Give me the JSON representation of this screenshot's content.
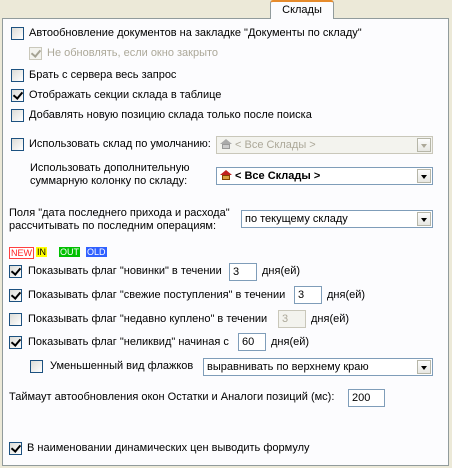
{
  "tab": {
    "label": "Склады"
  },
  "options": {
    "auto_update_docs": "Автообновление документов на закладке \"Документы по складу\"",
    "no_update_closed": "Не обновлять, если окно закрыто",
    "fetch_full_query": "Брать с сервера весь запрос",
    "show_sections": "Отображать секции склада в таблице",
    "add_after_search": "Добавлять новую позицию склада только после поиска",
    "use_default_warehouse": "Использовать склад по умолчанию:",
    "default_warehouse_value": "< Все Склады >",
    "extra_column_label_1": "Использовать дополнительную",
    "extra_column_label_2": "суммарную колонку по складу:",
    "extra_column_value": "< Все Склады >",
    "date_fields_label_1": "Поля \"дата последнего прихода и расхода\"",
    "date_fields_label_2": "рассчитывать по последним операциям:",
    "date_fields_value": "по текущему складу"
  },
  "flags": {
    "badges": [
      "NEW",
      "IN",
      "OUT",
      "OLD"
    ],
    "new_label": "Показывать флаг \"новинки\" в течении",
    "new_days": "3",
    "fresh_label": "Показывать флаг \"свежие поступления\" в течении",
    "fresh_days": "3",
    "recent_label": "Показывать флаг \"недавно куплено\" в течении",
    "recent_days": "3",
    "illiquid_label": "Показывать флаг \"неликвид\" начиная с",
    "illiquid_days": "60",
    "days_unit": "дня(ей)",
    "small_flags_label": "Уменьшенный вид флажков",
    "align_value": "выравнивать по верхнему краю"
  },
  "timeout": {
    "label": "Таймаут автообновления окон Остатки и Аналоги позиций (мс):",
    "value": "200"
  },
  "formula": {
    "label": "В наименовании динамических цен выводить формулу"
  },
  "colors": {
    "new": "#ff3030",
    "in": "#ffff00",
    "out": "#00c000",
    "old": "#3060ff"
  }
}
